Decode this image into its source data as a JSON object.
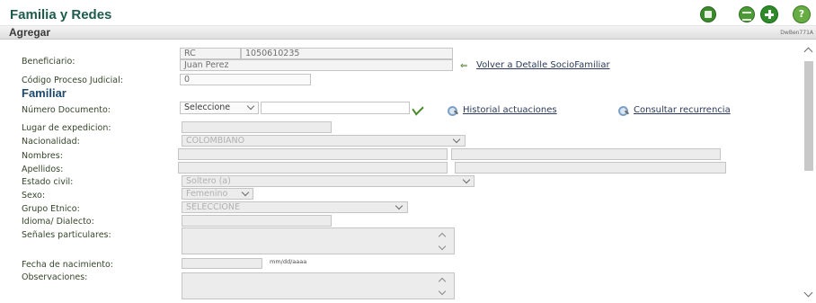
{
  "header": {
    "title": "Familia y Redes",
    "icons": [
      "save-icon",
      "grid-icon",
      "add-icon",
      "help-icon"
    ]
  },
  "section": {
    "title": "Agregar",
    "code": "DwBen771A"
  },
  "beneficiario": {
    "label": "Beneficiario:",
    "doc_type": "RC",
    "doc_number": "1050610235",
    "name": "Juan Perez",
    "back_link": "Volver a Detalle SocioFamiliar"
  },
  "codigo_proceso": {
    "label": "Código Proceso Judicial:",
    "value": "0"
  },
  "familiar": {
    "heading": "Familiar",
    "numero_documento": {
      "label": "Número Documento:",
      "select_value": "Seleccione",
      "input_value": "",
      "historial_link": "Historial actuaciones",
      "consultar_link": "Consultar recurrencia"
    },
    "lugar_expedicion": {
      "label": "Lugar de expedicion:",
      "value": ""
    },
    "nacionalidad": {
      "label": "Nacionalidad:",
      "value": "COLOMBIANO"
    },
    "nombres": {
      "label": "Nombres:",
      "first": "",
      "second": ""
    },
    "apellidos": {
      "label": "Apellidos:",
      "first": "",
      "second": ""
    },
    "estado_civil": {
      "label": "Estado civil:",
      "value": "Soltero (a)"
    },
    "sexo": {
      "label": "Sexo:",
      "value": "Femenino"
    },
    "grupo_etnico": {
      "label": "Grupo Etnico:",
      "value": "SELECCIONE"
    },
    "idioma": {
      "label": "Idioma/ Dialecto:",
      "value": ""
    },
    "senales": {
      "label": "Señales particulares:",
      "value": ""
    },
    "fecha_nacimiento": {
      "label": "Fecha de nacimiento:",
      "value": "",
      "format_hint": "mm/dd/aaaa"
    },
    "observaciones": {
      "label": "Observaciones:",
      "value": ""
    }
  },
  "colors": {
    "title_green": "#1d5c4c",
    "subheading_blue": "#1d4a6e",
    "check_green": "#4c8a2f"
  }
}
